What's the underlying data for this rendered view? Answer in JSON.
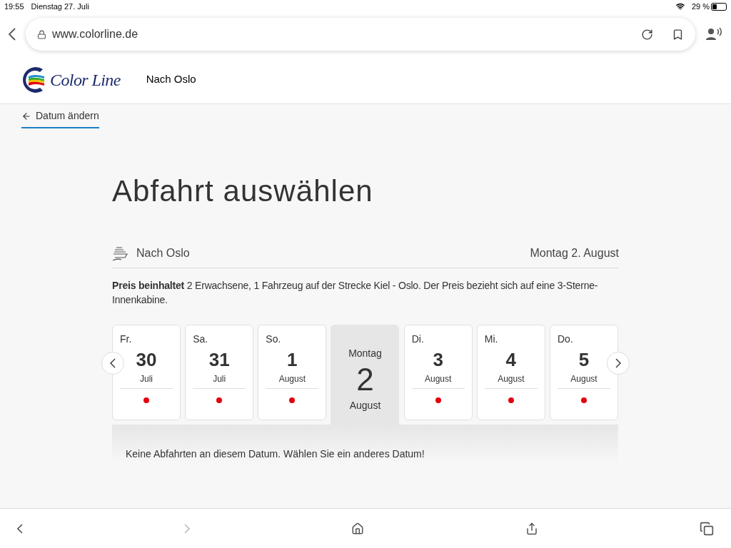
{
  "status_bar": {
    "time": "19:55",
    "date": "Dienstag 27. Juli",
    "battery": "29 %"
  },
  "browser": {
    "url": "www.colorline.de",
    "forward_disabled": true
  },
  "header": {
    "logo": "Color Line",
    "nav": "Nach Oslo"
  },
  "back_link": "Datum ändern",
  "title": "Abfahrt auswählen",
  "route": {
    "label": "Nach Oslo",
    "date": "Montag 2. August"
  },
  "price_note": "**Preis beinhaltet** 2 Erwachsene, 1 Fahrzeug auf der Strecke Kiel - Oslo. Der Preis bezieht sich auf eine 3-Sterne-Innenkabine.",
  "days": [
    {
      "weekday": "Fr.",
      "day": "30",
      "month": "Juli",
      "selected": false
    },
    {
      "weekday": "Sa.",
      "day": "31",
      "month": "Juli",
      "selected": false
    },
    {
      "weekday": "So.",
      "day": "1",
      "month": "August",
      "selected": false
    },
    {
      "weekday": "Montag",
      "day": "2",
      "month": "August",
      "selected": true
    },
    {
      "weekday": "Di.",
      "day": "3",
      "month": "August",
      "selected": false
    },
    {
      "weekday": "Mi.",
      "day": "4",
      "month": "August",
      "selected": false
    },
    {
      "weekday": "Do.",
      "day": "5",
      "month": "August",
      "selected": false
    }
  ],
  "message": "Keine Abfahrten an diesem Datum. Wählen Sie ein anderes Datum!"
}
